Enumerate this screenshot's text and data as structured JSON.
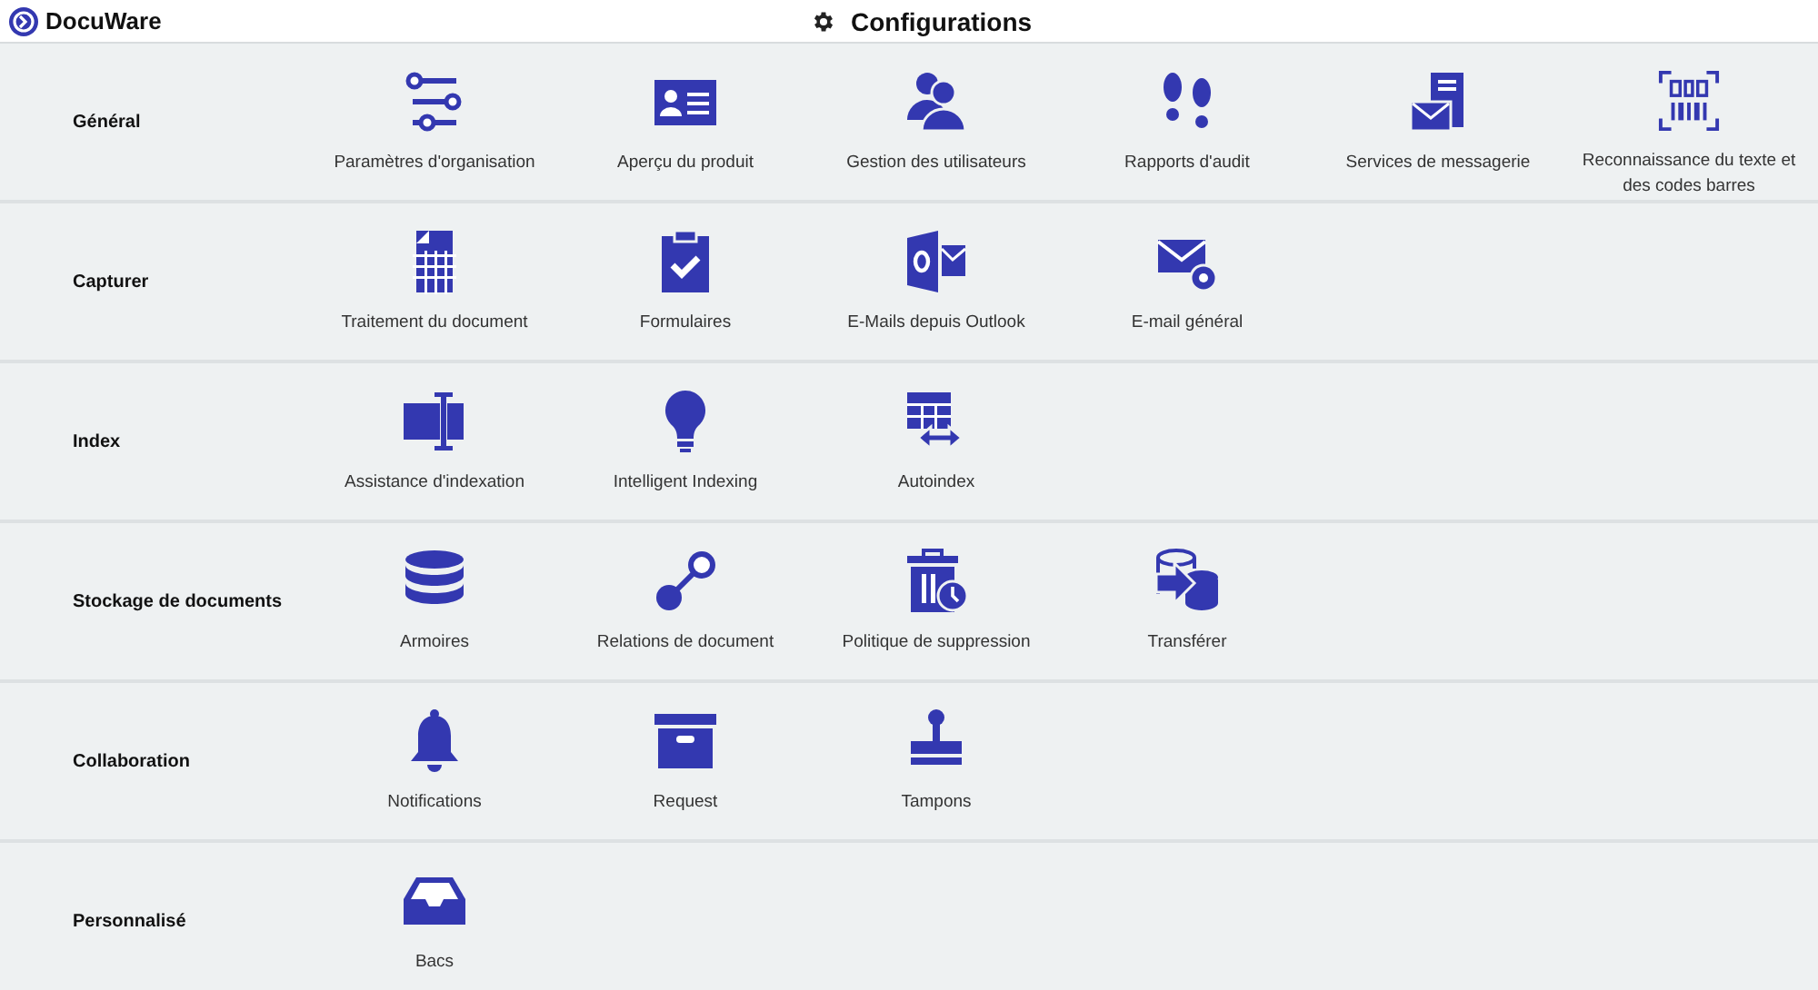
{
  "header": {
    "logo": "DocuWare",
    "title": "Configurations"
  },
  "sections": [
    {
      "title": "Général",
      "items": [
        {
          "label": "Paramètres d'organisation"
        },
        {
          "label": "Aperçu du produit"
        },
        {
          "label": "Gestion des utilisateurs"
        },
        {
          "label": "Rapports d'audit"
        },
        {
          "label": "Services de messagerie"
        },
        {
          "label": "Reconnaissance du texte et des codes barres"
        }
      ]
    },
    {
      "title": "Capturer",
      "items": [
        {
          "label": "Traitement du document"
        },
        {
          "label": "Formulaires"
        },
        {
          "label": "E-Mails depuis Outlook"
        },
        {
          "label": "E-mail général"
        }
      ]
    },
    {
      "title": "Index",
      "items": [
        {
          "label": "Assistance d'indexation"
        },
        {
          "label": "Intelligent Indexing"
        },
        {
          "label": "Autoindex"
        }
      ]
    },
    {
      "title": "Stockage de documents",
      "items": [
        {
          "label": "Armoires"
        },
        {
          "label": "Relations de document"
        },
        {
          "label": "Politique de suppression"
        },
        {
          "label": "Transférer"
        }
      ]
    },
    {
      "title": "Collaboration",
      "items": [
        {
          "label": "Notifications"
        },
        {
          "label": "Request"
        },
        {
          "label": "Tampons"
        }
      ]
    },
    {
      "title": "Personnalisé",
      "items": [
        {
          "label": "Bacs"
        }
      ]
    }
  ]
}
